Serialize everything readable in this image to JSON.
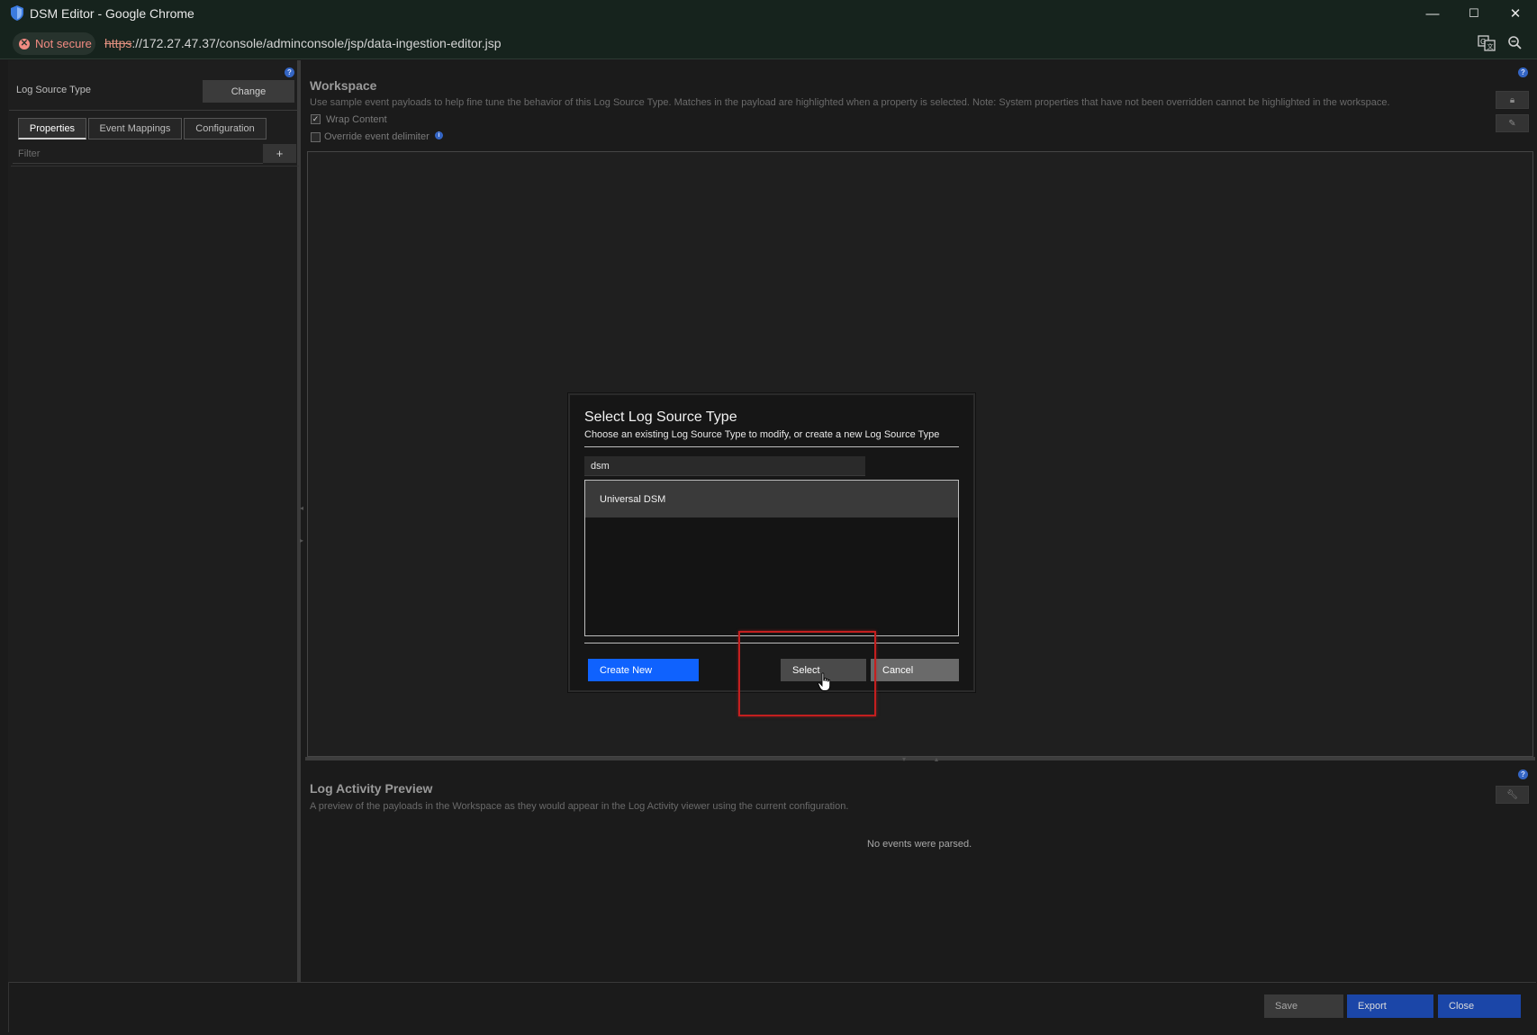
{
  "window": {
    "title": "DSM Editor - Google Chrome",
    "controls": {
      "minimize": "—",
      "maximize": "☐",
      "close": "✕"
    }
  },
  "addressbar": {
    "security_label": "Not secure",
    "url_scheme": "https",
    "url_rest": "://172.27.47.37/console/adminconsole/jsp/data-ingestion-editor.jsp",
    "translate_icon": "translate-icon",
    "zoom_icon": "zoom-icon"
  },
  "left_panel": {
    "log_source_type_label": "Log Source Type",
    "change_button": "Change",
    "tabs": [
      {
        "label": "Properties",
        "active": true
      },
      {
        "label": "Event Mappings",
        "active": false
      },
      {
        "label": "Configuration",
        "active": false
      }
    ],
    "filter_placeholder": "Filter",
    "add_button": "+"
  },
  "workspace": {
    "title": "Workspace",
    "description": "Use sample event payloads to help fine tune the behavior of this Log Source Type. Matches in the payload are highlighted when a property is selected. Note: System properties that have not been overridden cannot be highlighted in the workspace.",
    "wrap_content_label": "Wrap Content",
    "wrap_content_checked": true,
    "override_delimiter_label": "Override event delimiter",
    "override_delimiter_checked": false
  },
  "log_activity_preview": {
    "title": "Log Activity Preview",
    "description": "A preview of the payloads in the Workspace as they would appear in the Log Activity viewer using the current configuration.",
    "empty_message": "No events were parsed."
  },
  "footer": {
    "save": "Save",
    "export": "Export",
    "close": "Close"
  },
  "modal": {
    "title": "Select Log Source Type",
    "description": "Choose an existing Log Source Type to modify, or create a new Log Source Type",
    "search_value": "dsm",
    "results": [
      "Universal DSM"
    ],
    "create_new": "Create New",
    "select": "Select",
    "cancel": "Cancel"
  },
  "colors": {
    "primary_blue": "#0f62fe",
    "footer_blue": "#1b46a8",
    "highlight_red": "#c41f1f",
    "not_secure": "#f28b82"
  }
}
